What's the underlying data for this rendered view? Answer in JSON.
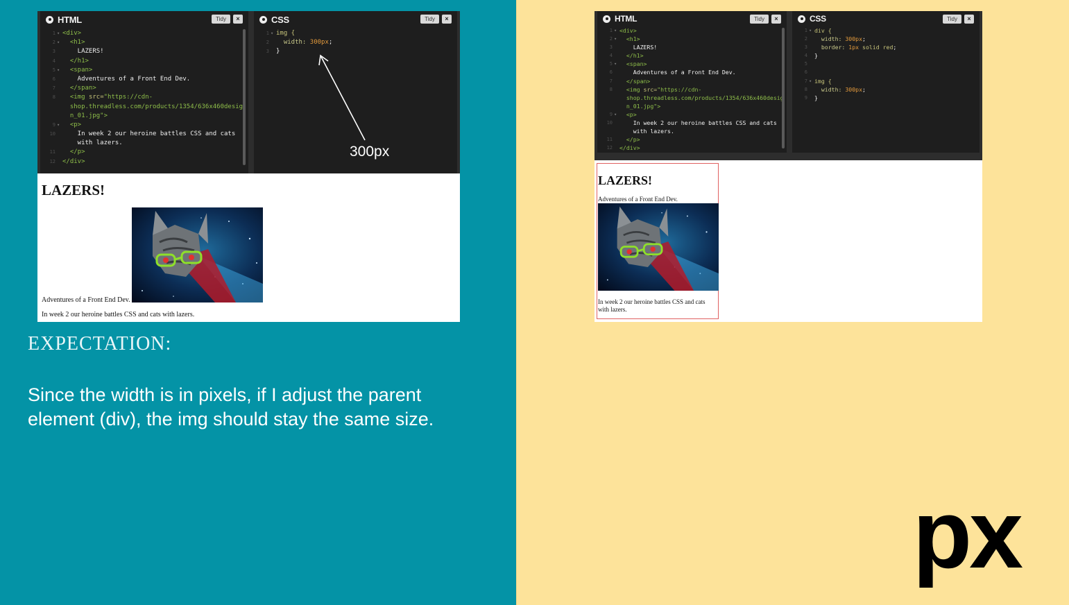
{
  "left": {
    "html_pane": {
      "title": "HTML",
      "tidy_label": "Tidy",
      "close_label": "×",
      "lines": [
        {
          "n": "1",
          "fold": "▾",
          "parts": [
            {
              "c": "tag",
              "t": "<div>"
            }
          ]
        },
        {
          "n": "2",
          "fold": "▾",
          "parts": [
            {
              "c": "tag",
              "t": "  <h1>"
            }
          ]
        },
        {
          "n": "3",
          "fold": "",
          "parts": [
            {
              "c": "txt",
              "t": "    LAZERS!"
            }
          ]
        },
        {
          "n": "4",
          "fold": "",
          "parts": [
            {
              "c": "tag",
              "t": "  </h1>"
            }
          ]
        },
        {
          "n": "5",
          "fold": "▾",
          "parts": [
            {
              "c": "tag",
              "t": "  <span>"
            }
          ]
        },
        {
          "n": "6",
          "fold": "",
          "parts": [
            {
              "c": "txt",
              "t": "    Adventures of a Front End Dev."
            }
          ]
        },
        {
          "n": "7",
          "fold": "",
          "parts": [
            {
              "c": "tag",
              "t": "  </span>"
            }
          ]
        },
        {
          "n": "8",
          "fold": "",
          "parts": [
            {
              "c": "tag",
              "t": "  <img "
            },
            {
              "c": "attr",
              "t": "src="
            },
            {
              "c": "str",
              "t": "\"https://cdn-"
            }
          ]
        },
        {
          "n": "",
          "fold": "",
          "parts": [
            {
              "c": "str",
              "t": "  shop.threadless.com/products/1354/636x460desig"
            }
          ]
        },
        {
          "n": "",
          "fold": "",
          "parts": [
            {
              "c": "str",
              "t": "  n_01.jpg\""
            },
            {
              "c": "tag",
              "t": ">"
            }
          ]
        },
        {
          "n": "9",
          "fold": "▾",
          "parts": [
            {
              "c": "tag",
              "t": "  <p>"
            }
          ]
        },
        {
          "n": "10",
          "fold": "",
          "parts": [
            {
              "c": "txt",
              "t": "    In week 2 our heroine battles CSS and cats"
            }
          ]
        },
        {
          "n": "",
          "fold": "",
          "parts": [
            {
              "c": "txt",
              "t": "    with lazers."
            }
          ]
        },
        {
          "n": "11",
          "fold": "",
          "parts": [
            {
              "c": "tag",
              "t": "  </p>"
            }
          ]
        },
        {
          "n": "12",
          "fold": "",
          "parts": [
            {
              "c": "tag",
              "t": "</div>"
            }
          ]
        }
      ]
    },
    "css_pane": {
      "title": "CSS",
      "tidy_label": "Tidy",
      "close_label": "×",
      "lines": [
        {
          "n": "1",
          "fold": "▾",
          "parts": [
            {
              "c": "sel",
              "t": "img {"
            }
          ]
        },
        {
          "n": "2",
          "fold": "",
          "parts": [
            {
              "c": "prop",
              "t": "  width: "
            },
            {
              "c": "num",
              "t": "300px"
            },
            {
              "c": "txt",
              "t": ";"
            }
          ]
        },
        {
          "n": "3",
          "fold": "",
          "parts": [
            {
              "c": "txt",
              "t": "}"
            }
          ]
        }
      ]
    },
    "annotation": "300px",
    "preview": {
      "heading": "LAZERS!",
      "span_text": "Adventures of a Front End Dev.",
      "paragraph": "In week 2 our heroine battles CSS and cats with lazers."
    },
    "caption_title": "EXPECTATION:",
    "caption_body": "Since the width is in pixels, if I adjust the parent element (div), the img should stay the same size."
  },
  "right": {
    "html_pane": {
      "title": "HTML",
      "tidy_label": "Tidy",
      "close_label": "×",
      "lines": [
        {
          "n": "1",
          "fold": "▾",
          "parts": [
            {
              "c": "tag",
              "t": "<div>"
            }
          ]
        },
        {
          "n": "2",
          "fold": "▾",
          "parts": [
            {
              "c": "tag",
              "t": "  <h1>"
            }
          ]
        },
        {
          "n": "3",
          "fold": "",
          "parts": [
            {
              "c": "txt",
              "t": "    LAZERS!"
            }
          ]
        },
        {
          "n": "4",
          "fold": "",
          "parts": [
            {
              "c": "tag",
              "t": "  </h1>"
            }
          ]
        },
        {
          "n": "5",
          "fold": "▾",
          "parts": [
            {
              "c": "tag",
              "t": "  <span>"
            }
          ]
        },
        {
          "n": "6",
          "fold": "",
          "parts": [
            {
              "c": "txt",
              "t": "    Adventures of a Front End Dev."
            }
          ]
        },
        {
          "n": "7",
          "fold": "",
          "parts": [
            {
              "c": "tag",
              "t": "  </span>"
            }
          ]
        },
        {
          "n": "8",
          "fold": "",
          "parts": [
            {
              "c": "tag",
              "t": "  <img "
            },
            {
              "c": "attr",
              "t": "src="
            },
            {
              "c": "str",
              "t": "\"https://cdn-"
            }
          ]
        },
        {
          "n": "",
          "fold": "",
          "parts": [
            {
              "c": "str",
              "t": "  shop.threadless.com/products/1354/636x460desig"
            }
          ]
        },
        {
          "n": "",
          "fold": "",
          "parts": [
            {
              "c": "str",
              "t": "  n_01.jpg\""
            },
            {
              "c": "tag",
              "t": ">"
            }
          ]
        },
        {
          "n": "9",
          "fold": "▾",
          "parts": [
            {
              "c": "tag",
              "t": "  <p>"
            }
          ]
        },
        {
          "n": "10",
          "fold": "",
          "parts": [
            {
              "c": "txt",
              "t": "    In week 2 our heroine battles CSS and cats"
            }
          ]
        },
        {
          "n": "",
          "fold": "",
          "parts": [
            {
              "c": "txt",
              "t": "    with lazers."
            }
          ]
        },
        {
          "n": "11",
          "fold": "",
          "parts": [
            {
              "c": "tag",
              "t": "  </p>"
            }
          ]
        },
        {
          "n": "12",
          "fold": "",
          "parts": [
            {
              "c": "tag",
              "t": "</div>"
            }
          ]
        }
      ]
    },
    "css_pane": {
      "title": "CSS",
      "tidy_label": "Tidy",
      "close_label": "×",
      "lines": [
        {
          "n": "1",
          "fold": "▾",
          "parts": [
            {
              "c": "sel",
              "t": "div {"
            }
          ]
        },
        {
          "n": "2",
          "fold": "",
          "parts": [
            {
              "c": "prop",
              "t": "  width: "
            },
            {
              "c": "num",
              "t": "300px"
            },
            {
              "c": "txt",
              "t": ";"
            }
          ]
        },
        {
          "n": "3",
          "fold": "",
          "parts": [
            {
              "c": "prop",
              "t": "  border: "
            },
            {
              "c": "num",
              "t": "1px"
            },
            {
              "c": "sel",
              "t": " solid red"
            },
            {
              "c": "txt",
              "t": ";"
            }
          ]
        },
        {
          "n": "4",
          "fold": "",
          "parts": [
            {
              "c": "txt",
              "t": "}"
            }
          ]
        },
        {
          "n": "5",
          "fold": "",
          "parts": []
        },
        {
          "n": "6",
          "fold": "",
          "parts": []
        },
        {
          "n": "7",
          "fold": "▾",
          "parts": [
            {
              "c": "sel",
              "t": "img {"
            }
          ]
        },
        {
          "n": "8",
          "fold": "",
          "parts": [
            {
              "c": "prop",
              "t": "  width: "
            },
            {
              "c": "num",
              "t": "300px"
            },
            {
              "c": "txt",
              "t": ";"
            }
          ]
        },
        {
          "n": "9",
          "fold": "",
          "parts": [
            {
              "c": "txt",
              "t": "}"
            }
          ]
        }
      ]
    },
    "preview": {
      "heading": "LAZERS!",
      "span_text": "Adventures of a Front End Dev.",
      "paragraph": "In week 2 our heroine battles CSS and cats with lazers."
    },
    "big_unit": "px"
  },
  "colors": {
    "left_bg": "#0493a6",
    "right_bg": "#fde39a",
    "editor_bg": "#1e1e1e",
    "div_border": "#e06060"
  }
}
